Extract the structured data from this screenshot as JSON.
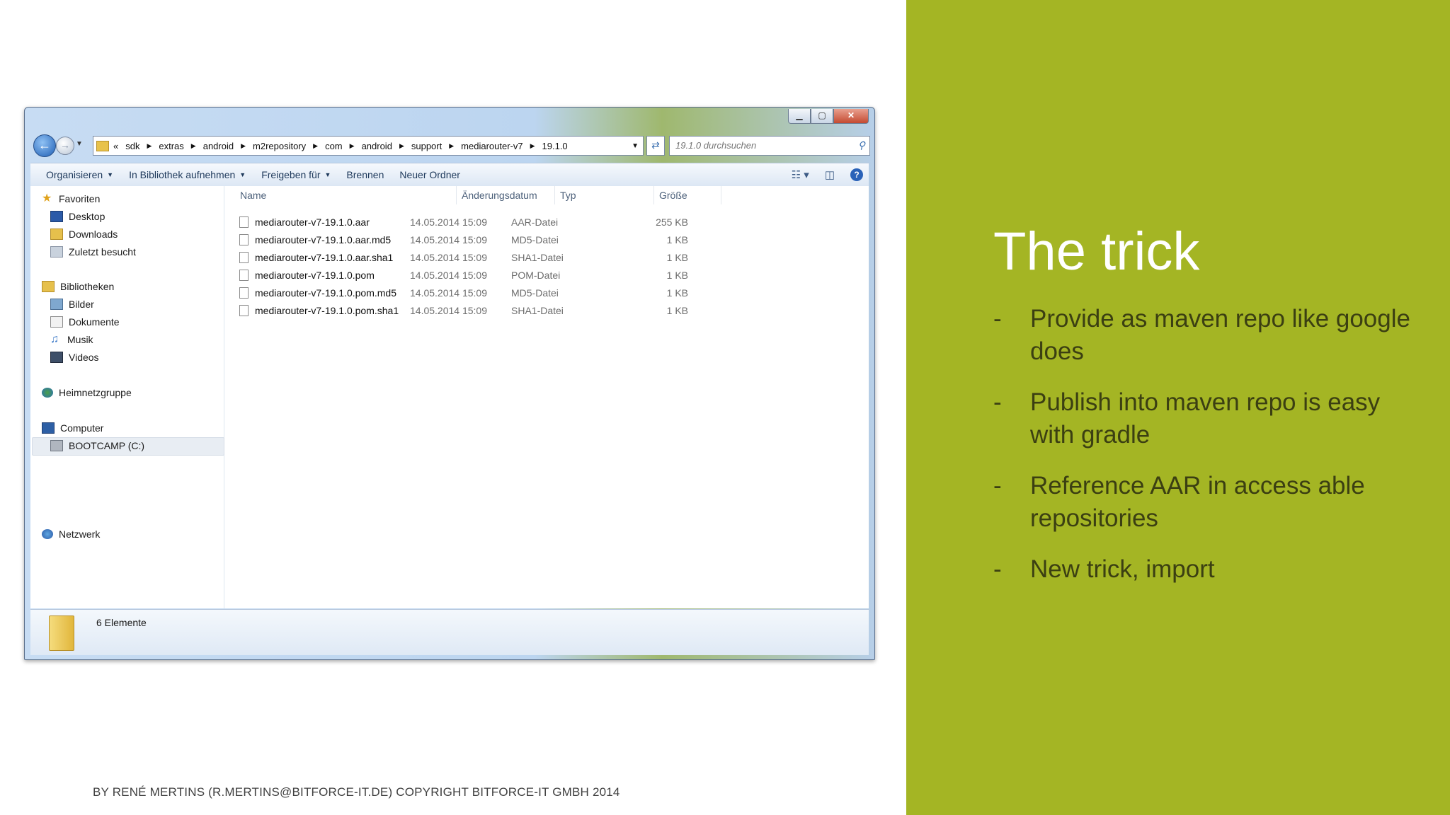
{
  "slide": {
    "title": "The trick",
    "bullets": [
      "Provide as maven repo like google does",
      "Publish into maven repo is easy with gradle",
      "Reference AAR in access able repositories",
      "New trick, import"
    ],
    "bullet_marker": "-",
    "footer": "BY RENÉ MERTINS (R.MERTINS@BITFORCE-IT.DE) COPYRIGHT BITFORCE-IT GMBH 2014",
    "colors": {
      "accent_panel": "#a4b524",
      "title_text": "#ffffff",
      "bullet_text": "#3b3f12"
    }
  },
  "explorer": {
    "window_controls": {
      "minimize": "▁",
      "maximize": "▢",
      "close": "✕"
    },
    "address": {
      "prefix": "«",
      "crumbs": [
        "sdk",
        "extras",
        "android",
        "m2repository",
        "com",
        "android",
        "support",
        "mediarouter-v7",
        "19.1.0"
      ]
    },
    "search_placeholder": "19.1.0 durchsuchen",
    "toolbar": {
      "organize": "Organisieren",
      "library": "In Bibliothek aufnehmen",
      "share": "Freigeben für",
      "burn": "Brennen",
      "new_folder": "Neuer Ordner"
    },
    "nav": {
      "favorites": "Favoriten",
      "desktop": "Desktop",
      "downloads": "Downloads",
      "recent": "Zuletzt besucht",
      "libraries": "Bibliotheken",
      "pictures": "Bilder",
      "documents": "Dokumente",
      "music": "Musik",
      "videos": "Videos",
      "homegroup": "Heimnetzgruppe",
      "computer": "Computer",
      "drive": "BOOTCAMP (C:)",
      "network": "Netzwerk"
    },
    "columns": {
      "name": "Name",
      "date": "Änderungsdatum",
      "type": "Typ",
      "size": "Größe"
    },
    "files": [
      {
        "name": "mediarouter-v7-19.1.0.aar",
        "date": "14.05.2014 15:09",
        "type": "AAR-Datei",
        "size": "255 KB"
      },
      {
        "name": "mediarouter-v7-19.1.0.aar.md5",
        "date": "14.05.2014 15:09",
        "type": "MD5-Datei",
        "size": "1 KB"
      },
      {
        "name": "mediarouter-v7-19.1.0.aar.sha1",
        "date": "14.05.2014 15:09",
        "type": "SHA1-Datei",
        "size": "1 KB"
      },
      {
        "name": "mediarouter-v7-19.1.0.pom",
        "date": "14.05.2014 15:09",
        "type": "POM-Datei",
        "size": "1 KB"
      },
      {
        "name": "mediarouter-v7-19.1.0.pom.md5",
        "date": "14.05.2014 15:09",
        "type": "MD5-Datei",
        "size": "1 KB"
      },
      {
        "name": "mediarouter-v7-19.1.0.pom.sha1",
        "date": "14.05.2014 15:09",
        "type": "SHA1-Datei",
        "size": "1 KB"
      }
    ],
    "status": "6 Elemente"
  }
}
